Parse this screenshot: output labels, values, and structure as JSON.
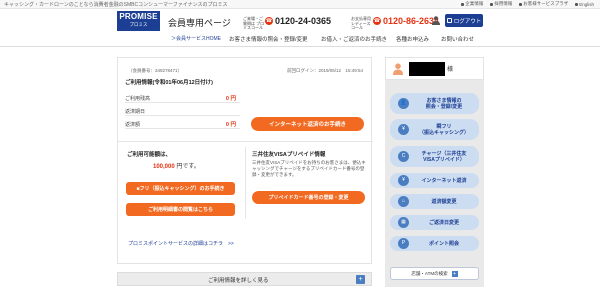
{
  "top_strip": {
    "tagline": "キャッシング・カードローンのことなら消費者金融のSMBCコンシューマーファイナンスのプロミス",
    "links": [
      "企業情報",
      "採用情報",
      "お客様サービスプラザ",
      "English"
    ]
  },
  "header": {
    "logo_brand": "PROMISE",
    "logo_sub": "プロミス",
    "member_page": "会員専用ページ",
    "inquiry_note_1": "ご来場・ご質問は プロミスコール",
    "phone_1": "0120-24-0365",
    "inquiry_note_2": "お支払専用 レディースコール",
    "phone_2": "0120-86-2634",
    "logout_label": "ログアウト"
  },
  "nav": {
    "home": "＞会員サービスHOME",
    "items": [
      "お客さま情報の照会・登録/変更",
      "お借入・ご返済のお手続き",
      "各種お申込み",
      "お問い合わせ"
    ]
  },
  "main": {
    "member_number": "（会員番号：349278471）",
    "last_login": "前回ログイン：2019/06/12　15:49:54",
    "usage_title": "ご利用情報(令和01年06月12日付け)",
    "rows": [
      {
        "label": "ご利用残高",
        "value": "0 円"
      },
      {
        "label": "返済期日",
        "value": ""
      },
      {
        "label": "返済額",
        "value": "0 円"
      }
    ],
    "net_button": "インターネット返済のお手続き",
    "limit_title": "ご利用可能額は、",
    "limit_amount": "100,000",
    "limit_suffix": "円です。",
    "furikomi_button": "■フリ（振込キャッシング）のお手続き",
    "statement_button": "ご利用明細書の閲覧はこちら",
    "visa_title": "三井住友VISAプリペイド情報",
    "visa_desc": "三井住友VISAプリペイドをお持ちのお客さまは、便込キャッシングでチャージをするプリペイドカード番号の登録・変更ができます。",
    "visa_button": "プリペイドカード番号の登録・変更",
    "points_link": "プロミスポイントサービスの詳細はコチラ　>>"
  },
  "detail_bar": {
    "label": "ご利用情報を詳しく見る",
    "plus": "+"
  },
  "side": {
    "sama": "様",
    "buttons": [
      {
        "icon": "👤",
        "label": "お客さま情報の\n照会・登録/変更"
      },
      {
        "icon": "¥",
        "label": "瞬フリ\n（振込キャッシング）"
      },
      {
        "icon": "C",
        "label": "チャージ（三井住友\nVISAプリペイド）"
      },
      {
        "icon": "¥",
        "label": "インターネット返済"
      },
      {
        "icon": "⌂",
        "label": "返済額変更"
      },
      {
        "icon": "▦",
        "label": "ご返済日変更"
      },
      {
        "icon": "P",
        "label": "ポイント照会"
      }
    ],
    "store_label": "店舗・ATMの検索",
    "store_plus": "+"
  },
  "colors": {
    "brand_blue": "#1c3f94",
    "accent_orange": "#f26a22",
    "alert_red": "#e63312",
    "side_button_bg": "#ccdcf1"
  }
}
